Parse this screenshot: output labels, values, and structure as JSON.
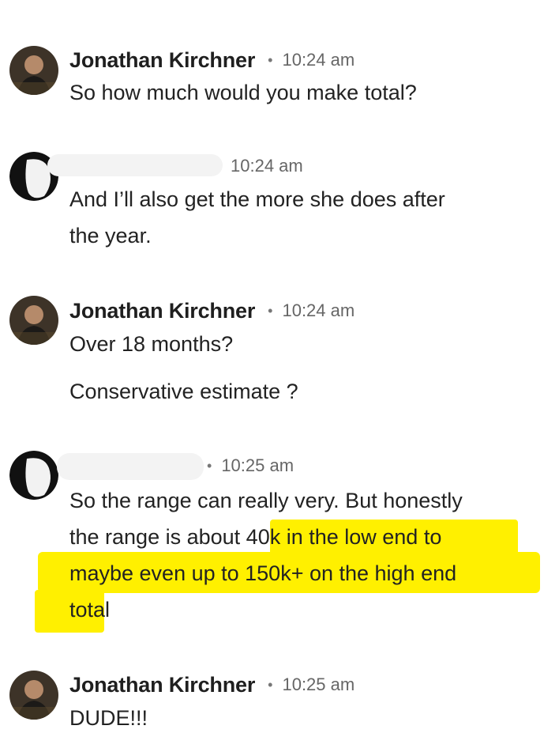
{
  "messages": [
    {
      "name": "Jonathan Kirchner",
      "time": "10:24 am",
      "lines": [
        "So how much would you make total?"
      ]
    },
    {
      "name": "",
      "time": "10:24 am",
      "lines": [
        "And I’ll also get the more she does after",
        "the year."
      ]
    },
    {
      "name": "Jonathan Kirchner",
      "time": "10:24 am",
      "lines": [
        "Over 18 months?",
        "Conservative estimate ?"
      ]
    },
    {
      "name": "",
      "time": "10:25 am",
      "lines": [
        "So the range can really very. But honestly",
        "the range is about ",
        "40k in the low end to",
        "maybe even up to 150k+ on the high end",
        "total"
      ]
    },
    {
      "name": "Jonathan Kirchner",
      "time": "10:25 am",
      "lines": [
        "DUDE!!!"
      ]
    }
  ],
  "colors": {
    "highlight": "#fff000",
    "text": "#222222",
    "meta": "#666666"
  },
  "icons": {
    "separator": "dot-icon",
    "avatar": "avatar-photo"
  }
}
